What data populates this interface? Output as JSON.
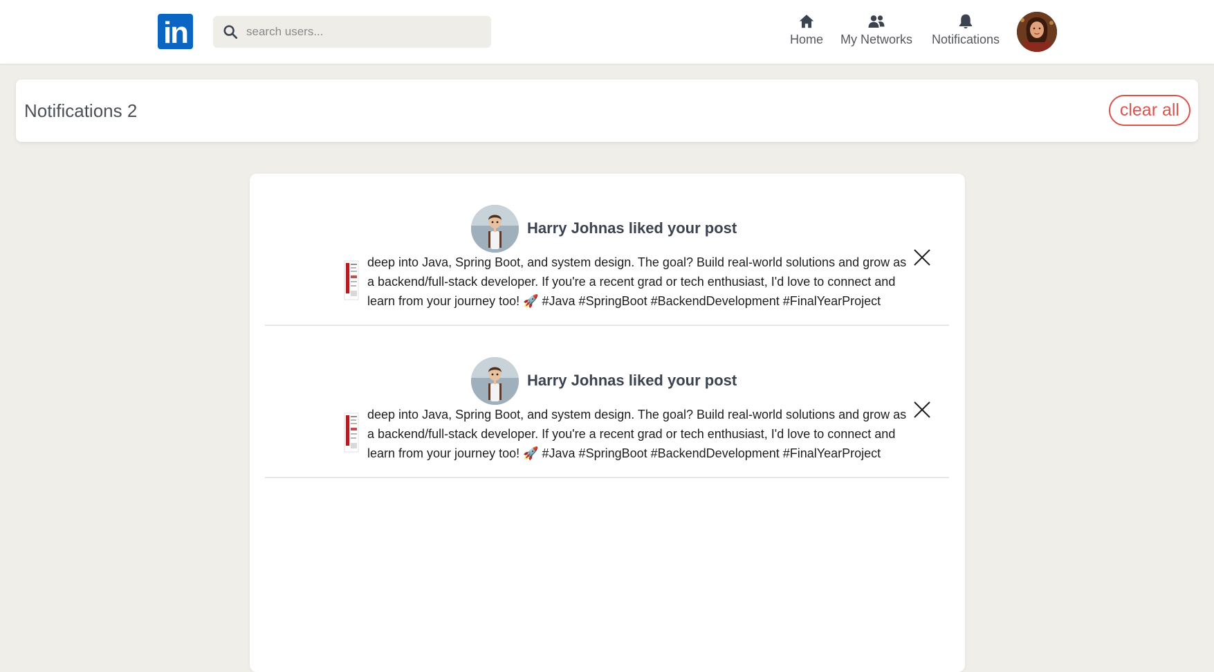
{
  "navbar": {
    "logo_text": "in",
    "search": {
      "placeholder": "search users...",
      "value": ""
    },
    "items": [
      {
        "label": "Home",
        "icon": "home-icon"
      },
      {
        "label": "My Networks",
        "icon": "people-icon"
      },
      {
        "label": "Notifications",
        "icon": "bell-icon"
      }
    ]
  },
  "header": {
    "title": "Notifications 2",
    "clear_all_label": "clear all"
  },
  "notifications": [
    {
      "headline": "Harry Johnas liked your post",
      "post_excerpt": "deep into Java, Spring Boot, and system design. The goal? Build real-world solutions and grow as a backend/full-stack developer. If you're a recent grad or tech enthusiast, I'd love to connect and learn from your journey too! 🚀 #Java #SpringBoot #BackendDevelopment #FinalYearProject"
    },
    {
      "headline": "Harry Johnas liked your post",
      "post_excerpt": "deep into Java, Spring Boot, and system design. The goal? Build real-world solutions and grow as a backend/full-stack developer. If you're a recent grad or tech enthusiast, I'd love to connect and learn from your journey too! 🚀 #Java #SpringBoot #BackendDevelopment #FinalYearProject"
    }
  ],
  "colors": {
    "brand": "#0a66c2",
    "danger": "#d9534f",
    "page_bg": "#f0eee9"
  }
}
